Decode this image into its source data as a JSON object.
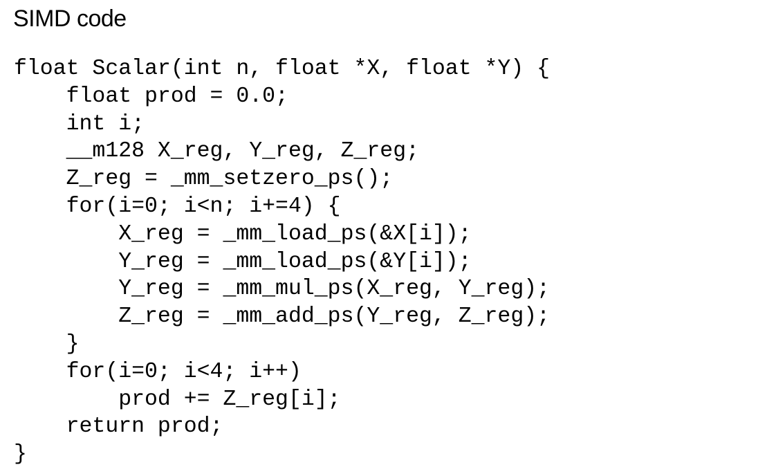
{
  "title": "SIMD code",
  "code_lines": [
    "float Scalar(int n, float *X, float *Y) {",
    "    float prod = 0.0;",
    "    int i;",
    "    __m128 X_reg, Y_reg, Z_reg;",
    "    Z_reg = _mm_setzero_ps();",
    "    for(i=0; i<n; i+=4) {",
    "        X_reg = _mm_load_ps(&X[i]);",
    "        Y_reg = _mm_load_ps(&Y[i]);",
    "        Y_reg = _mm_mul_ps(X_reg, Y_reg);",
    "        Z_reg = _mm_add_ps(Y_reg, Z_reg);",
    "    }",
    "    for(i=0; i<4; i++)",
    "        prod += Z_reg[i];",
    "    return prod;",
    "}"
  ]
}
